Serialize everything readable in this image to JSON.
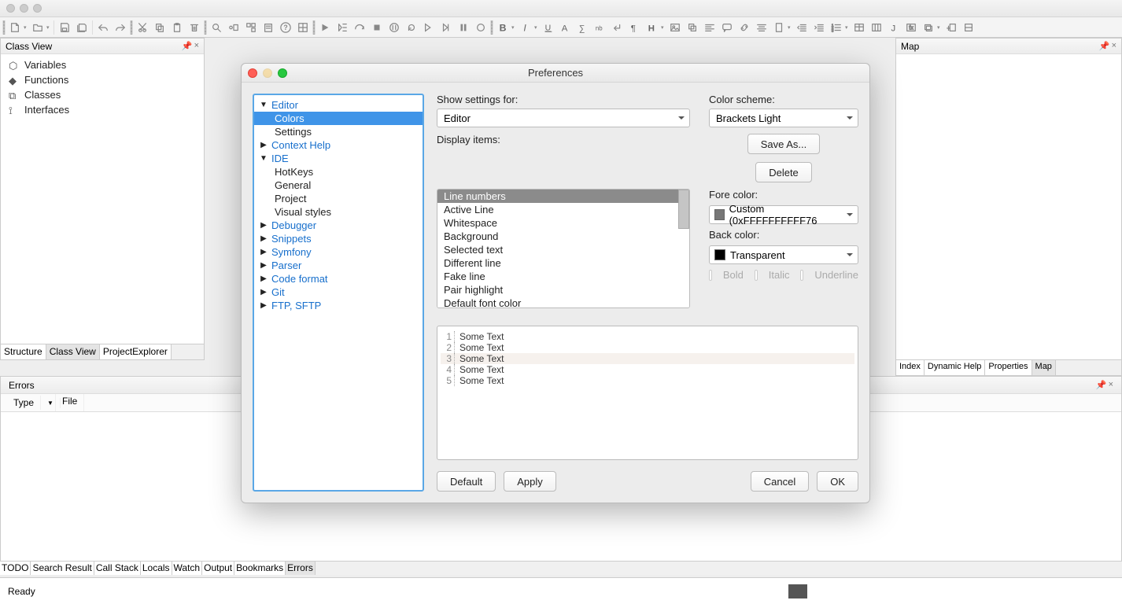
{
  "titlebar": {},
  "classView": {
    "title": "Class View",
    "items": [
      {
        "icon": "variables-icon",
        "label": "Variables"
      },
      {
        "icon": "functions-icon",
        "label": "Functions"
      },
      {
        "icon": "classes-icon",
        "label": "Classes"
      },
      {
        "icon": "interfaces-icon",
        "label": "Interfaces"
      }
    ],
    "tabs": [
      "Structure",
      "Class View",
      "ProjectExplorer"
    ],
    "activeTab": "Class View"
  },
  "mapPanel": {
    "title": "Map",
    "tabs": [
      "Index",
      "Dynamic Help",
      "Properties",
      "Map"
    ],
    "activeTab": "Map"
  },
  "errorsPanel": {
    "title": "Errors",
    "columns": [
      "Type",
      "File"
    ]
  },
  "bottomTabs": {
    "tabs": [
      "TODO",
      "Search Result",
      "Call Stack",
      "Locals",
      "Watch",
      "Output",
      "Bookmarks",
      "Errors"
    ],
    "activeTab": "Errors"
  },
  "statusBar": {
    "text": "Ready"
  },
  "dialog": {
    "title": "Preferences",
    "tree": [
      {
        "label": "Editor",
        "expand": "down",
        "level": 0
      },
      {
        "label": "Colors",
        "level": 1,
        "selected": true
      },
      {
        "label": "Settings",
        "level": 1
      },
      {
        "label": "Context Help",
        "expand": "right",
        "level": 0
      },
      {
        "label": "IDE",
        "expand": "down",
        "level": 0
      },
      {
        "label": "HotKeys",
        "level": 1
      },
      {
        "label": "General",
        "level": 1
      },
      {
        "label": "Project",
        "level": 1
      },
      {
        "label": "Visual styles",
        "level": 1
      },
      {
        "label": "Debugger",
        "expand": "right",
        "level": 0
      },
      {
        "label": "Snippets",
        "expand": "right",
        "level": 0
      },
      {
        "label": "Symfony",
        "expand": "right",
        "level": 0
      },
      {
        "label": "Parser",
        "expand": "right",
        "level": 0
      },
      {
        "label": "Code format",
        "expand": "right",
        "level": 0
      },
      {
        "label": "Git",
        "expand": "right",
        "level": 0
      },
      {
        "label": "FTP, SFTP",
        "expand": "right",
        "level": 0
      }
    ],
    "labels": {
      "showSettingsFor": "Show settings for:",
      "colorScheme": "Color scheme:",
      "displayItems": "Display items:",
      "foreColor": "Fore color:",
      "backColor": "Back color:",
      "saveAs": "Save As...",
      "delete": "Delete",
      "bold": "Bold",
      "italic": "Italic",
      "underline": "Underline",
      "default": "Default",
      "apply": "Apply",
      "cancel": "Cancel",
      "ok": "OK"
    },
    "showSettingsValue": "Editor",
    "colorSchemeValue": "Brackets Light",
    "displayItems": [
      "Line numbers",
      "Active Line",
      "Whitespace",
      "Background",
      "Selected text",
      "Different line",
      "Fake line",
      "Pair highlight",
      "Default font color"
    ],
    "selectedDisplayItem": "Line numbers",
    "foreColor": {
      "label": "Custom (0xFFFFFFFFFF76",
      "swatch": "#777777"
    },
    "backColor": {
      "label": "Transparent",
      "swatch": "#000000"
    },
    "preview": {
      "lines": [
        {
          "n": "1",
          "t": "Some Text"
        },
        {
          "n": "2",
          "t": "Some Text"
        },
        {
          "n": "3",
          "t": "Some Text",
          "hl": true
        },
        {
          "n": "4",
          "t": "Some Text"
        },
        {
          "n": "5",
          "t": "Some Text"
        }
      ]
    }
  }
}
